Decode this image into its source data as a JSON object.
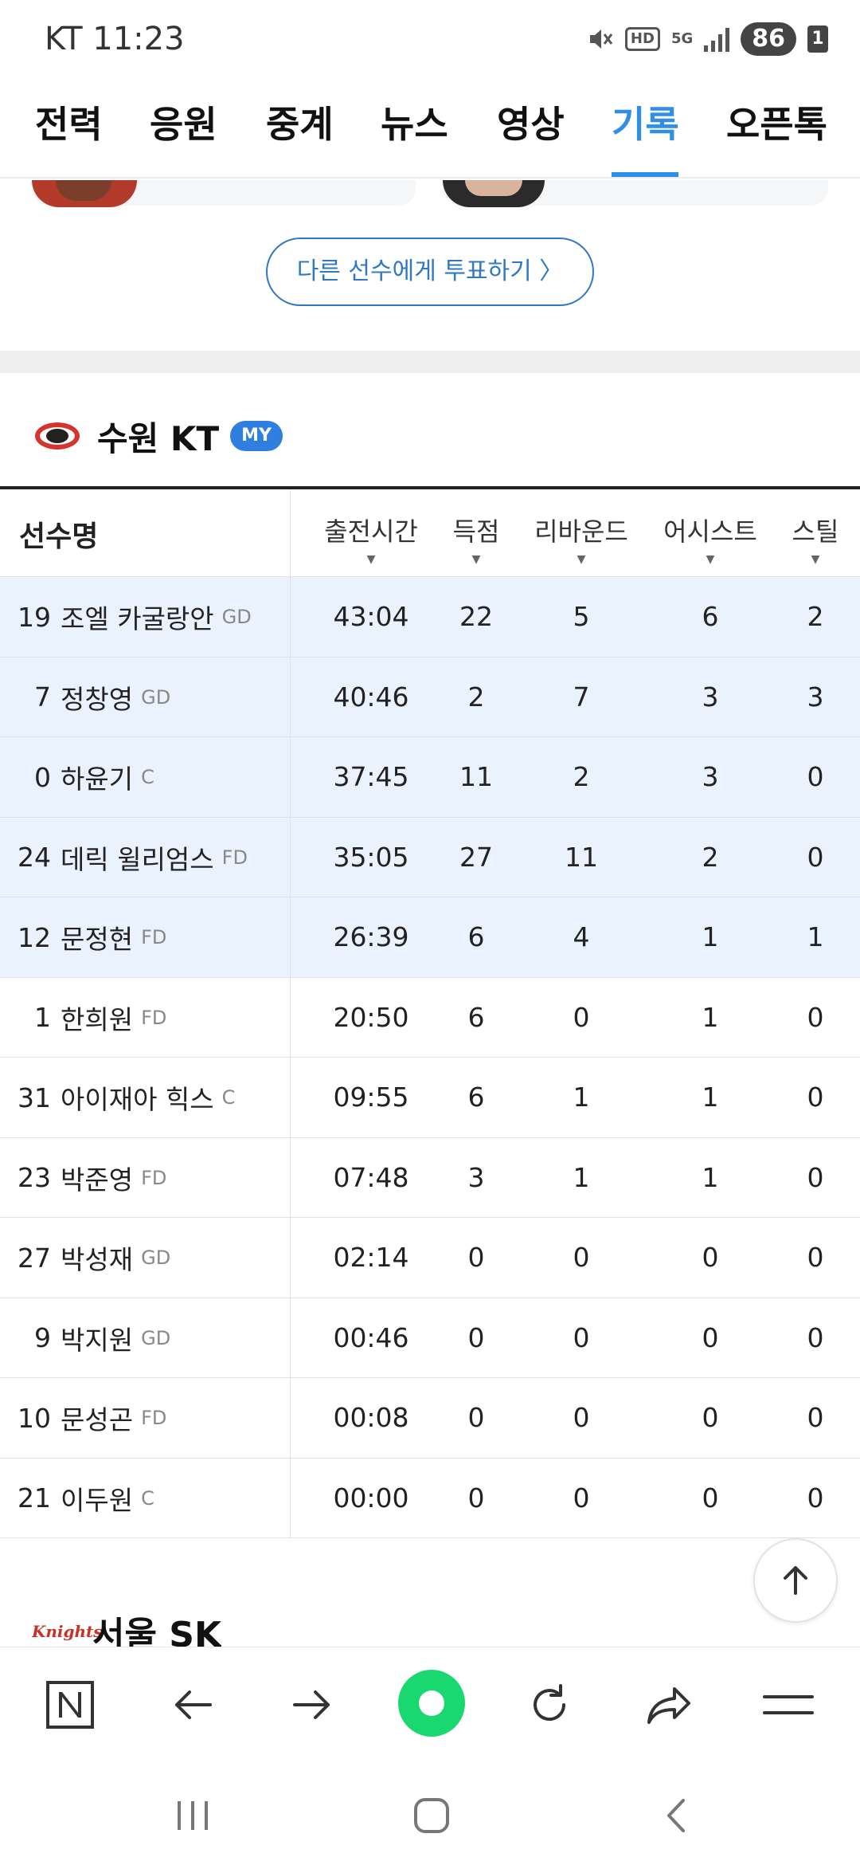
{
  "status_bar": {
    "carrier_time": "KT 11:23",
    "hd_label": "HD",
    "network_label": "5G",
    "battery": "86",
    "sim": "1"
  },
  "tabs": [
    {
      "label": "전력",
      "active": false
    },
    {
      "label": "응원",
      "active": false
    },
    {
      "label": "중계",
      "active": false
    },
    {
      "label": "뉴스",
      "active": false
    },
    {
      "label": "영상",
      "active": false
    },
    {
      "label": "기록",
      "active": true
    },
    {
      "label": "오픈톡",
      "active": false
    }
  ],
  "vote_button": "다른 선수에게 투표하기 〉",
  "team": {
    "name": "수원 KT",
    "badge": "MY"
  },
  "table": {
    "name_header": "선수명",
    "columns": [
      "출전시간",
      "득점",
      "리바운드",
      "어시스트",
      "스틸"
    ],
    "rows": [
      {
        "num": "19",
        "name": "조엘 카굴랑안",
        "pos": "GD",
        "starter": true,
        "stats": [
          "43:04",
          "22",
          "5",
          "6",
          "2"
        ]
      },
      {
        "num": "7",
        "name": "정창영",
        "pos": "GD",
        "starter": true,
        "stats": [
          "40:46",
          "2",
          "7",
          "3",
          "3"
        ]
      },
      {
        "num": "0",
        "name": "하윤기",
        "pos": "C",
        "starter": true,
        "stats": [
          "37:45",
          "11",
          "2",
          "3",
          "0"
        ]
      },
      {
        "num": "24",
        "name": "데릭 윌리엄스",
        "pos": "FD",
        "starter": true,
        "stats": [
          "35:05",
          "27",
          "11",
          "2",
          "0"
        ]
      },
      {
        "num": "12",
        "name": "문정현",
        "pos": "FD",
        "starter": true,
        "stats": [
          "26:39",
          "6",
          "4",
          "1",
          "1"
        ]
      },
      {
        "num": "1",
        "name": "한희원",
        "pos": "FD",
        "starter": false,
        "stats": [
          "20:50",
          "6",
          "0",
          "1",
          "0"
        ]
      },
      {
        "num": "31",
        "name": "아이재아 힉스",
        "pos": "C",
        "starter": false,
        "stats": [
          "09:55",
          "6",
          "1",
          "1",
          "0"
        ]
      },
      {
        "num": "23",
        "name": "박준영",
        "pos": "FD",
        "starter": false,
        "stats": [
          "07:48",
          "3",
          "1",
          "1",
          "0"
        ]
      },
      {
        "num": "27",
        "name": "박성재",
        "pos": "GD",
        "starter": false,
        "stats": [
          "02:14",
          "0",
          "0",
          "0",
          "0"
        ]
      },
      {
        "num": "9",
        "name": "박지원",
        "pos": "GD",
        "starter": false,
        "stats": [
          "00:46",
          "0",
          "0",
          "0",
          "0"
        ]
      },
      {
        "num": "10",
        "name": "문성곤",
        "pos": "FD",
        "starter": false,
        "stats": [
          "00:08",
          "0",
          "0",
          "0",
          "0"
        ]
      },
      {
        "num": "21",
        "name": "이두원",
        "pos": "C",
        "starter": false,
        "stats": [
          "00:00",
          "0",
          "0",
          "0",
          "0"
        ]
      }
    ]
  },
  "team2": {
    "logo_text": "Knights",
    "name": "서울 SK"
  },
  "colors": {
    "accent": "#2f8fe6",
    "starter_row": "#eaf2fd",
    "launcher_green": "#19d86f"
  },
  "icons": {
    "browser_bar": [
      "naver-n-icon",
      "back-arrow-icon",
      "forward-arrow-icon",
      "green-home-icon",
      "refresh-icon",
      "share-icon",
      "menu-icon"
    ],
    "nav_bar": [
      "recent-apps-icon",
      "home-icon",
      "back-icon"
    ]
  }
}
